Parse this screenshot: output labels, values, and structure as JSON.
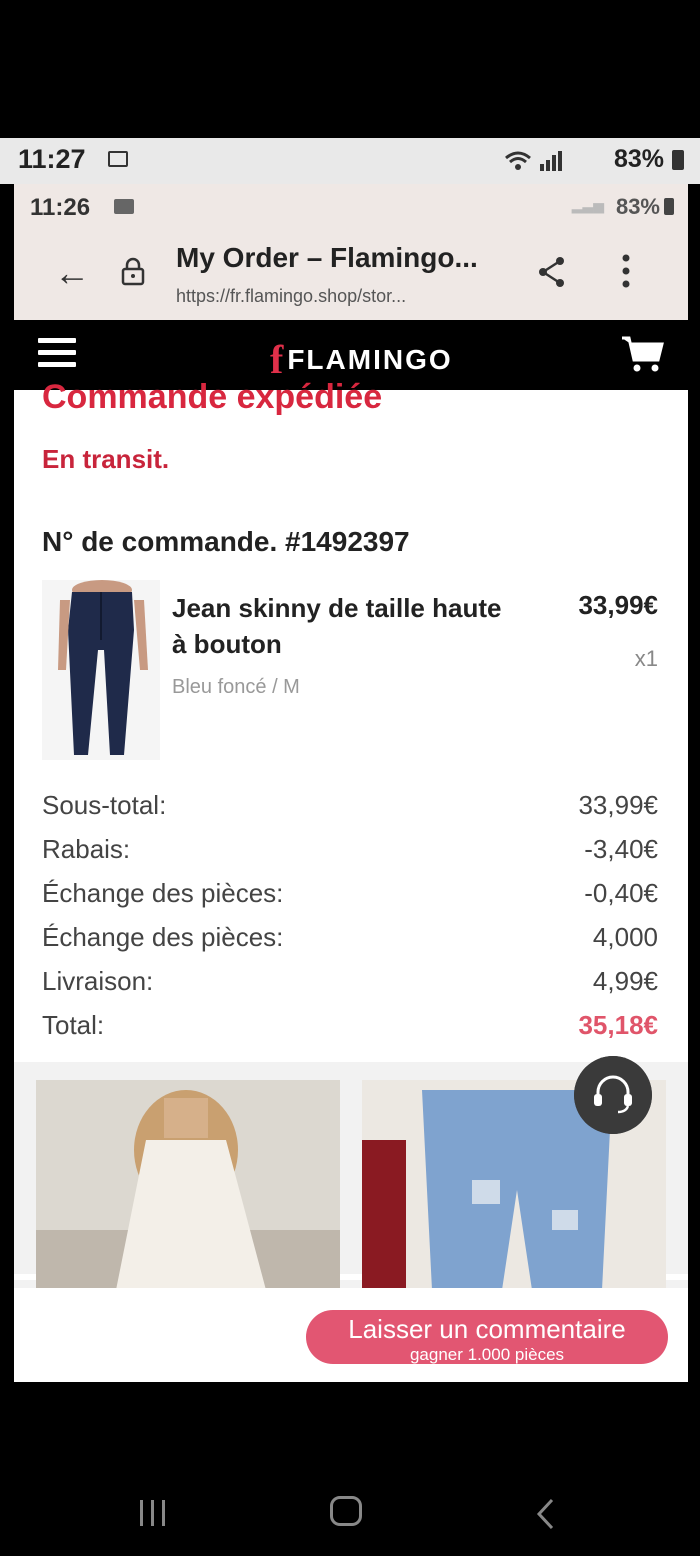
{
  "outer_status": {
    "time": "11:27",
    "battery": "83%"
  },
  "inner_status": {
    "time": "11:26",
    "battery": "83%"
  },
  "browser": {
    "page_title": "My Order – Flamingo...",
    "url": "https://fr.flamingo.shop/stor..."
  },
  "site": {
    "logo": "FLAMINGO"
  },
  "order": {
    "heading": "Commande expédiée",
    "status": "En transit.",
    "number_label": "N° de commande. #1492397"
  },
  "product": {
    "name": "Jean skinny de taille haute à bouton",
    "price": "33,99€",
    "qty": "x1",
    "variant": "Bleu foncé / M"
  },
  "summary": [
    {
      "label": "Sous-total:",
      "value": "33,99€"
    },
    {
      "label": "Rabais:",
      "value": "-3,40€"
    },
    {
      "label": "Échange des pièces:",
      "value": "-0,40€"
    },
    {
      "label": "Échange des pièces:",
      "value": "4,000"
    },
    {
      "label": "Livraison:",
      "value": "4,99€"
    },
    {
      "label": "Total:",
      "value": "35,18€"
    }
  ],
  "review": {
    "label": "Laisser un commentaire",
    "sub": "gagner 1.000 pièces"
  },
  "colors": {
    "brand_red": "#d8273f",
    "button_pink": "#e25672",
    "header_black": "#000000"
  }
}
